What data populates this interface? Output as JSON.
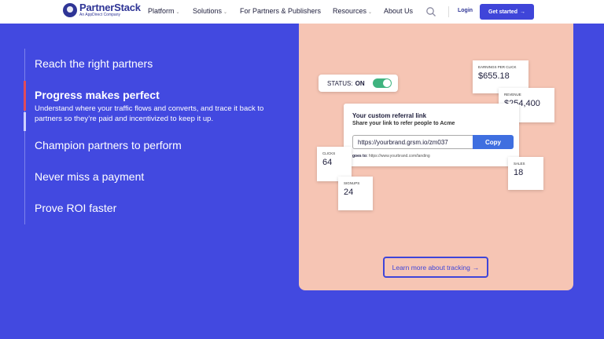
{
  "nav": {
    "logo_name": "PartnerStack",
    "logo_sub": "An AppDirect Company",
    "items": [
      {
        "label": "Platform",
        "chevron": "⌄"
      },
      {
        "label": "Solutions",
        "chevron": "⌄"
      },
      {
        "label": "For Partners & Publishers"
      },
      {
        "label": "Resources",
        "chevron": "⌄"
      },
      {
        "label": "About Us"
      }
    ],
    "login": "Login",
    "cta": "Get started",
    "cta_arrow": "→",
    "search_icon": "search-icon"
  },
  "features": {
    "items": [
      {
        "label": "Reach the right partners"
      },
      {
        "label": "Progress makes perfect",
        "description": "Understand where your traffic flows and converts, and trace it back to partners so they’re paid and incentivized to keep it up."
      },
      {
        "label": "Champion partners to perform"
      },
      {
        "label": "Never miss a payment"
      },
      {
        "label": "Prove ROI faster"
      }
    ]
  },
  "card": {
    "status_label": "STATUS:",
    "status_value": "ON",
    "earnings": {
      "label": "Earnings per click",
      "value": "$655.18"
    },
    "revenue": {
      "label": "Revenue",
      "value": "$254,400"
    },
    "clicks": {
      "label": "Clicks",
      "value": "64"
    },
    "signups": {
      "label": "Signups",
      "value": "24"
    },
    "sales": {
      "label": "Sales",
      "value": "18"
    },
    "referral": {
      "title": "Your custom referral link",
      "subtitle": "Share your link to refer people to Acme",
      "link": "https://yourbrand.grsm.io/zm037",
      "copy": "Copy",
      "goes_label": "goes to:",
      "goes_url": "https://www.yourbrand.com/landing"
    },
    "learn_more": "Learn more about tracking",
    "learn_arrow": "→"
  },
  "colors": {
    "background": "#4249e0",
    "card": "#f6c5b4",
    "accent": "#3f45d9",
    "active_marker": "#e04c5b",
    "toggle_on": "#3fb37f"
  }
}
